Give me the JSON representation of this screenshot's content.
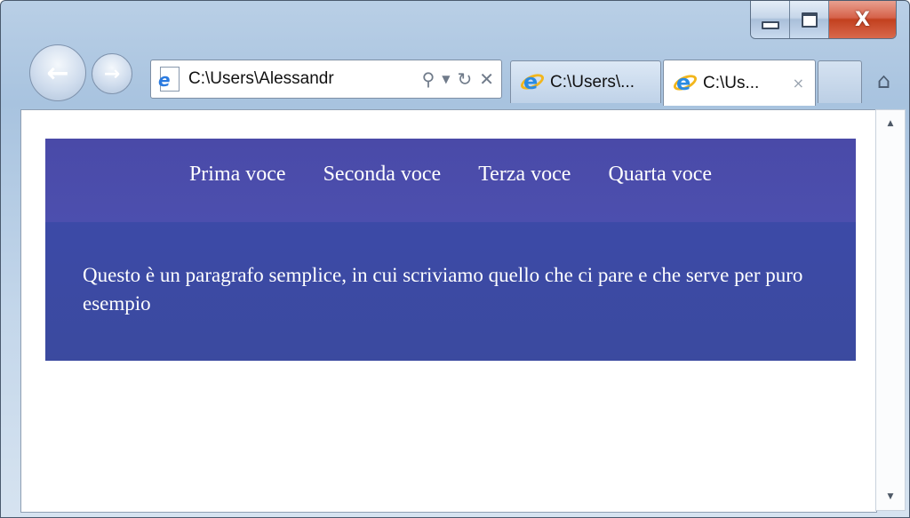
{
  "browser": {
    "address_bar": {
      "url": "C:\\Users\\Alessandr"
    },
    "tabs": [
      {
        "label": "C:\\Users\\...",
        "active": false
      },
      {
        "label": "C:\\Us...",
        "active": true,
        "close": "×"
      }
    ],
    "window_controls": {
      "close_label": "X"
    }
  },
  "page": {
    "nav": {
      "items": [
        "Prima voce",
        "Seconda voce",
        "Terza voce",
        "Quarta voce"
      ],
      "background": "#4a4aa8"
    },
    "content": {
      "paragraph": "Questo è un paragrafo semplice, in cui scriviamo quello che ci pare e che serve per puro esempio",
      "background": "#3c4aa7"
    },
    "text_color": "#ffffff"
  },
  "icons": [
    "back-icon",
    "forward-icon",
    "page-icon",
    "search-icon",
    "dropdown-icon",
    "refresh-icon",
    "stop-icon",
    "ie-icon",
    "home-icon",
    "minimize-icon",
    "maximize-icon",
    "close-icon"
  ]
}
